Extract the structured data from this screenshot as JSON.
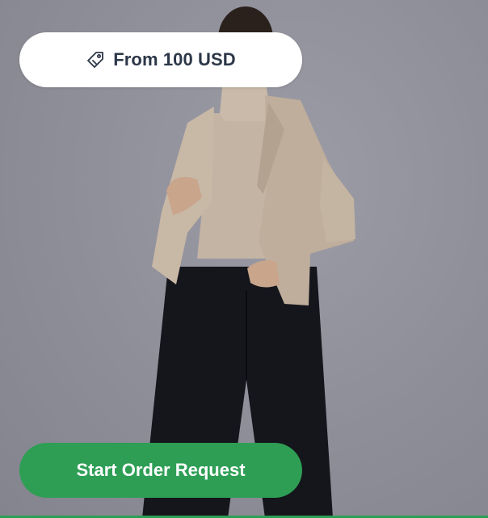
{
  "price_badge": {
    "label": "From 100 USD",
    "icon": "price-tag-icon"
  },
  "cta": {
    "label": "Start Order Request"
  },
  "photo": {
    "subject": "model-wearing-beige-cardigan-and-black-wide-trousers"
  },
  "colors": {
    "accent": "#2e9e55",
    "pill_bg": "#ffffff",
    "text": "#2d3748",
    "backdrop": "#8e8e98"
  }
}
